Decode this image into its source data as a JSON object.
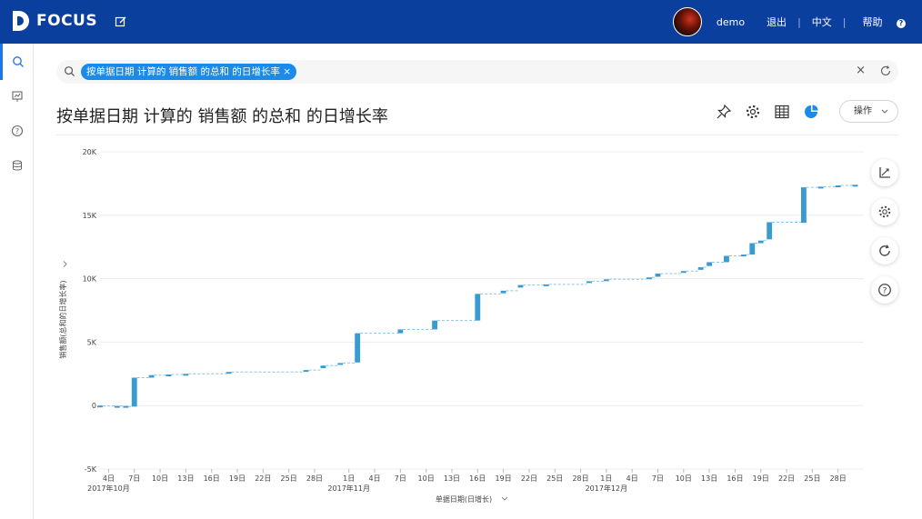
{
  "app": {
    "logo_text": "FOCUS"
  },
  "user": {
    "name": "demo",
    "logout": "退出",
    "language": "中文",
    "help": "帮助"
  },
  "search": {
    "chip_label": "按单据日期  计算的  销售额  的总和  的日增长率"
  },
  "page": {
    "title": "按单据日期 计算的 销售额 的总和 的日增长率",
    "ops_label": "操作"
  },
  "icons": {
    "sidebar": [
      "search-icon",
      "pin-board-icon",
      "help-icon",
      "database-icon"
    ],
    "toolbar": [
      "pin-icon",
      "gear-icon",
      "table-icon",
      "pie-chart-icon"
    ],
    "right": [
      "axis-icon",
      "gear-icon",
      "refresh-icon",
      "help-icon"
    ]
  },
  "colors": {
    "brand": "#0b3f9e",
    "bar": "#3a9bd1",
    "connector": "#8ac4e6",
    "accent": "#1b8ae8"
  },
  "chart_data": {
    "type": "bar",
    "subtype": "waterfall",
    "ylabel": "销售额(总和的日增长率)",
    "xlabel": "单据日期(日增长)",
    "ylim": [
      -5000,
      20000
    ],
    "yticks": [
      -5000,
      0,
      5000,
      10000,
      15000,
      20000
    ],
    "ytick_labels": [
      "-5K",
      "0",
      "5K",
      "10K",
      "15K",
      "20K"
    ],
    "grid": true,
    "x_date_range": [
      "2017-10-03",
      "2017-12-31"
    ],
    "xtick_labels": [
      "4日",
      "7日",
      "10日",
      "13日",
      "16日",
      "19日",
      "22日",
      "25日",
      "28日",
      "1日",
      "4日",
      "7日",
      "10日",
      "13日",
      "16日",
      "19日",
      "22日",
      "25日",
      "28日",
      "1日",
      "4日",
      "7日",
      "10日",
      "13日",
      "16日",
      "19日",
      "22日",
      "25日",
      "28日"
    ],
    "month_labels": [
      {
        "label": "2017年10月",
        "date": "2017-10-04"
      },
      {
        "label": "2017年11月",
        "date": "2017-11-01"
      },
      {
        "label": "2017年12月",
        "date": "2017-12-01"
      }
    ],
    "steps": [
      {
        "date": "2017-10-03",
        "from": 0,
        "to": -30
      },
      {
        "date": "2017-10-05",
        "from": -30,
        "to": -30
      },
      {
        "date": "2017-10-06",
        "from": -30,
        "to": -80
      },
      {
        "date": "2017-10-07",
        "from": -80,
        "to": 2200
      },
      {
        "date": "2017-10-09",
        "from": 2200,
        "to": 2400
      },
      {
        "date": "2017-10-11",
        "from": 2400,
        "to": 2450
      },
      {
        "date": "2017-10-13",
        "from": 2450,
        "to": 2500
      },
      {
        "date": "2017-10-18",
        "from": 2550,
        "to": 2650
      },
      {
        "date": "2017-10-27",
        "from": 2700,
        "to": 2800
      },
      {
        "date": "2017-10-29",
        "from": 2950,
        "to": 3150
      },
      {
        "date": "2017-10-31",
        "from": 3250,
        "to": 3350
      },
      {
        "date": "2017-11-02",
        "from": 3400,
        "to": 5700
      },
      {
        "date": "2017-11-07",
        "from": 5700,
        "to": 6000
      },
      {
        "date": "2017-11-11",
        "from": 6000,
        "to": 6700
      },
      {
        "date": "2017-11-16",
        "from": 6700,
        "to": 8800
      },
      {
        "date": "2017-11-19",
        "from": 8850,
        "to": 9050
      },
      {
        "date": "2017-11-21",
        "from": 9300,
        "to": 9500
      },
      {
        "date": "2017-11-24",
        "from": 9500,
        "to": 9550
      },
      {
        "date": "2017-11-29",
        "from": 9700,
        "to": 9800
      },
      {
        "date": "2017-12-01",
        "from": 9900,
        "to": 9950
      },
      {
        "date": "2017-12-06",
        "from": 10050,
        "to": 10100
      },
      {
        "date": "2017-12-07",
        "from": 10150,
        "to": 10400
      },
      {
        "date": "2017-12-10",
        "from": 10500,
        "to": 10600
      },
      {
        "date": "2017-12-12",
        "from": 10700,
        "to": 10900
      },
      {
        "date": "2017-12-13",
        "from": 11000,
        "to": 11300
      },
      {
        "date": "2017-12-15",
        "from": 11300,
        "to": 11800
      },
      {
        "date": "2017-12-17",
        "from": 11850,
        "to": 11900
      },
      {
        "date": "2017-12-18",
        "from": 11900,
        "to": 12800
      },
      {
        "date": "2017-12-19",
        "from": 12800,
        "to": 13000
      },
      {
        "date": "2017-12-20",
        "from": 13100,
        "to": 14450
      },
      {
        "date": "2017-12-24",
        "from": 14400,
        "to": 17200
      },
      {
        "date": "2017-12-26",
        "from": 17200,
        "to": 17250
      },
      {
        "date": "2017-12-28",
        "from": 17300,
        "to": 17350
      },
      {
        "date": "2017-12-30",
        "from": 17350,
        "to": 17400
      }
    ]
  }
}
